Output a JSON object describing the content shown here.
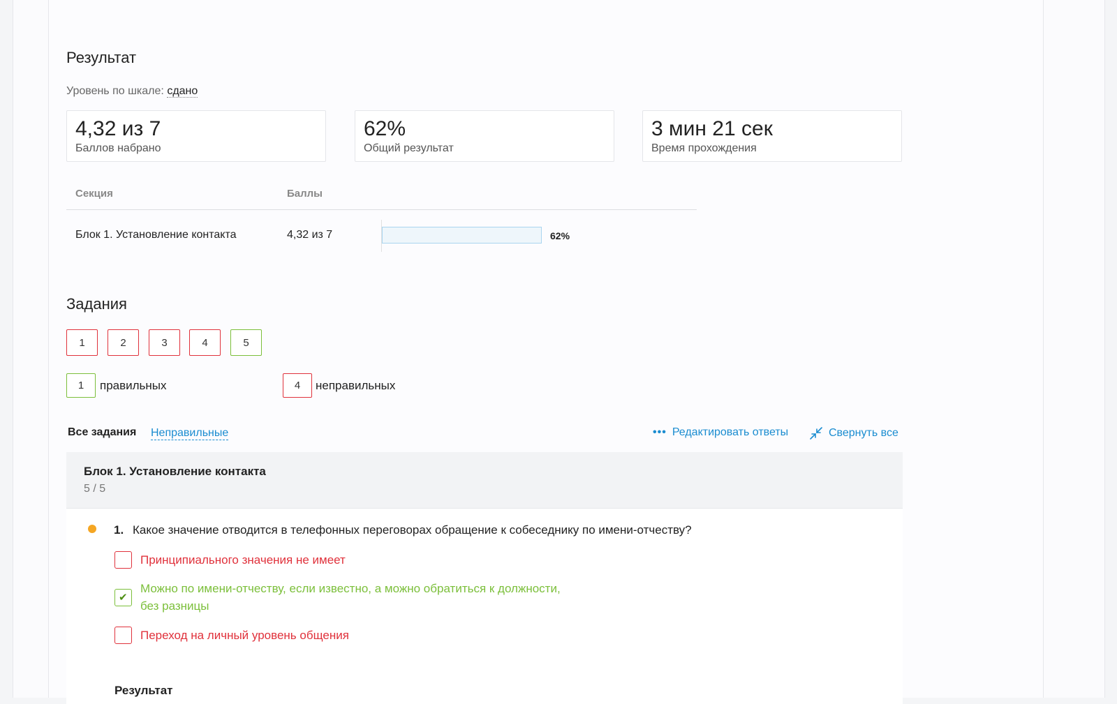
{
  "result": {
    "heading": "Результат",
    "scale_label": "Уровень по шкале:",
    "scale_value": "сдано",
    "cards": [
      {
        "value": "4,32 из 7",
        "label": "Баллов набрано"
      },
      {
        "value": "62%",
        "label": "Общий результат"
      },
      {
        "value": "3 мин 21 сек",
        "label": "Время прохождения"
      }
    ],
    "table": {
      "headers": [
        "Секция",
        "Баллы"
      ],
      "rows": [
        {
          "section": "Блок 1. Установление контакта",
          "score": "4,32 из 7",
          "percent_label": "62%",
          "progress": 0.62
        }
      ]
    }
  },
  "tasks": {
    "heading": "Задания",
    "buttons": [
      {
        "label": "1",
        "status": "wrong"
      },
      {
        "label": "2",
        "status": "wrong"
      },
      {
        "label": "3",
        "status": "wrong"
      },
      {
        "label": "4",
        "status": "wrong"
      },
      {
        "label": "5",
        "status": "correct"
      }
    ],
    "legend": {
      "correct_count": "1",
      "correct_label": "правильных",
      "wrong_count": "4",
      "wrong_label": "неправильных"
    }
  },
  "filters": {
    "all": "Все задания",
    "wrong": "Неправильные",
    "edit": "Редактировать ответы",
    "collapse": "Свернуть все"
  },
  "block": {
    "title": "Блок 1. Установление контакта",
    "count": "5 / 5"
  },
  "question": {
    "number": "1.",
    "text": "Какое значение отводится в телефонных переговорах обращение к собеседнику по имени-отчеству?",
    "options": [
      {
        "text": "Принципиального значения не имеет",
        "checked": false,
        "correct": false
      },
      {
        "text": "Можно по имени-отчеству, если известно, а можно обратиться к должности,",
        "text2": "без разницы",
        "checked": true,
        "correct": true
      },
      {
        "text": "Переход на личный уровень общения",
        "checked": false,
        "correct": false
      }
    ],
    "result_label": "Результат"
  },
  "colors": {
    "link": "#1a8cd0",
    "wrong": "#e0313b",
    "correct": "#7bbf3a",
    "marker": "#f5a623"
  }
}
